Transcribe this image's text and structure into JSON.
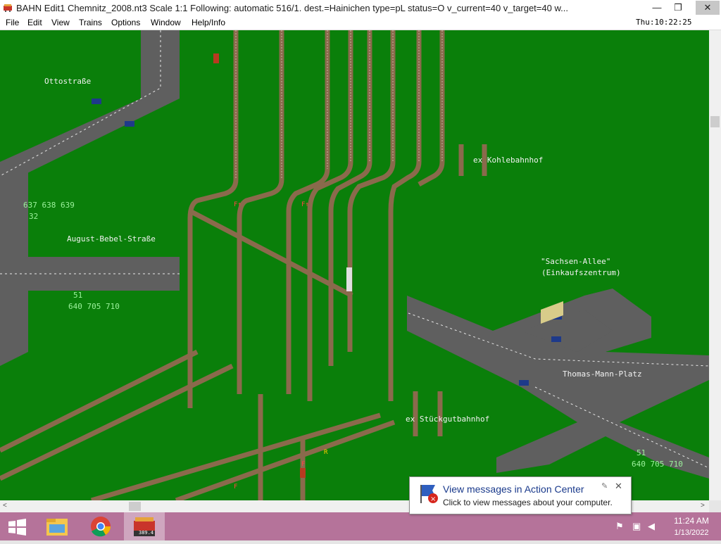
{
  "window": {
    "title": "BAHN Edit1 Chemnitz_2008.nt3 Scale 1:1 Following: automatic 516/1.  dest.=Hainichen type=pL status=O  v_current=40 v_target=40 w...",
    "minimize_glyph": "—",
    "restore_glyph": "❐",
    "close_glyph": "✕"
  },
  "menu": {
    "items": [
      "File",
      "Edit",
      "View",
      "Trains",
      "Options",
      "Window",
      "Help/Info"
    ],
    "clock": "Thu:10:22:25"
  },
  "map": {
    "labels": {
      "ottostrasse": "Ottostraße",
      "august_bebel": "August-Bebel-Straße",
      "kohlebahnhof": "ex Kohlebahnhof",
      "sachsen_allee": "\"Sachsen-Allee\"",
      "einkaufszentrum": "(Einkaufszentrum)",
      "thomas_mann": "Thomas-Mann-Platz",
      "stueckgut": "ex Stückgutbahnhof"
    },
    "line_numbers": {
      "nw_lines": "637 638 639",
      "nw_line_32": "32",
      "w_line_51": "51",
      "w_lines": "640 705 710",
      "se_line_51": "51",
      "se_lines": "640 705 710"
    },
    "colors": {
      "grass": "#0a7f0a",
      "road": "#5f5f5f",
      "track": "#8a6a4c"
    }
  },
  "scrollbars": {
    "left_arrow": "<",
    "right_arrow": ">"
  },
  "notification": {
    "title": "View messages in Action Center",
    "body": "Click to view messages about your computer.",
    "close": "✕",
    "pin": "✎"
  },
  "taskbar": {
    "time": "11:24 AM",
    "date": "1/13/2022",
    "apps": [
      "start-icon",
      "file-explorer-icon",
      "chrome-icon",
      "bahn-app-icon"
    ],
    "bahn_label": "389.4"
  }
}
